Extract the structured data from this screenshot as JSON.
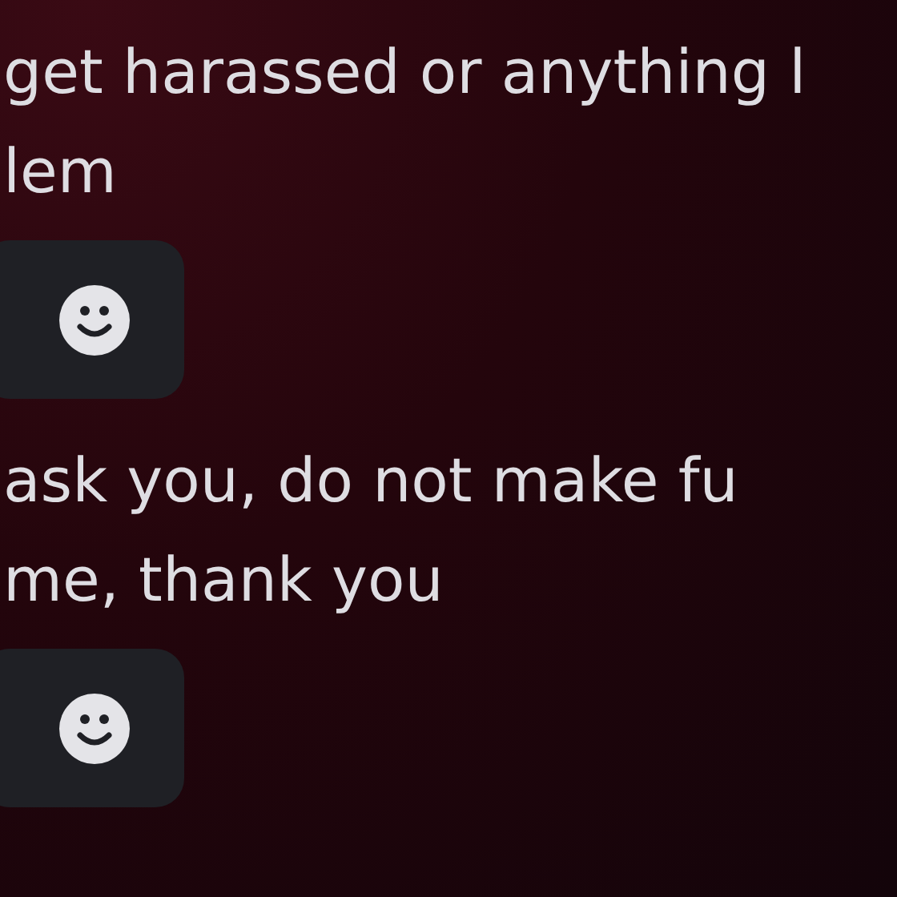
{
  "messages": [
    {
      "lines": [
        "get harassed or anything l",
        "lem"
      ],
      "has_reaction": true
    },
    {
      "lines": [
        "ask you, do not make fu",
        "me, thank you"
      ],
      "has_reaction": true
    }
  ]
}
